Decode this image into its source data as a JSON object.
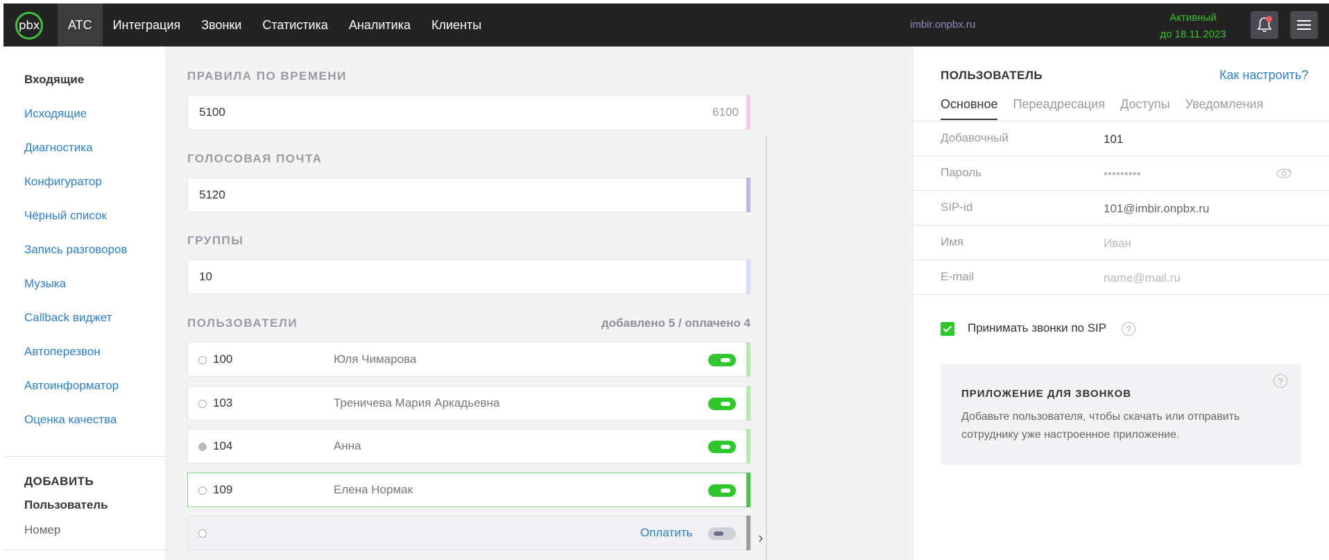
{
  "topbar": {
    "logo": "pbx",
    "nav": [
      "АТС",
      "Интеграция",
      "Звонки",
      "Статистика",
      "Аналитика",
      "Клиенты"
    ],
    "domain": "imbir.onpbx.ru",
    "status_line1": "Активный",
    "status_line2": "до 18.11.2023"
  },
  "sidebar": {
    "items": [
      "Входящие",
      "Исходящие",
      "Диагностика",
      "Конфигуратор",
      "Чёрный список",
      "Запись разговоров",
      "Музыка",
      "Callback виджет",
      "Автоперезвон",
      "Автоинформатор",
      "Оценка качества"
    ],
    "add_title": "ДОБАВИТЬ",
    "add_user": "Пользователь",
    "add_number": "Номер"
  },
  "middle": {
    "time_rules": {
      "title": "ПРАВИЛА ПО ВРЕМЕНИ",
      "value": "5100",
      "right": "6100",
      "bar_color": "#f7c9e6"
    },
    "voicemail": {
      "title": "ГОЛОСОВАЯ ПОЧТА",
      "value": "5120",
      "bar_color": "#c2b3ea"
    },
    "groups": {
      "title": "ГРУППЫ",
      "value": "10",
      "bar_color": "#d3dcfb"
    },
    "users": {
      "title": "ПОЛЬЗОВАТЕЛИ",
      "count": "добавлено 5 / оплачено 4",
      "rows": [
        {
          "ext": "100",
          "name": "Юля Чимарова"
        },
        {
          "ext": "103",
          "name": "Треничева Мария Аркадьевна"
        },
        {
          "ext": "104",
          "name": "Анна"
        },
        {
          "ext": "109",
          "name": "Елена Нормак"
        }
      ],
      "pay_label": "Оплатить"
    }
  },
  "user_panel": {
    "title": "ПОЛЬЗОВАТЕЛЬ",
    "help": "Как настроить?",
    "tabs": [
      "Основное",
      "Переадресация",
      "Доступы",
      "Уведомления"
    ],
    "fields": {
      "ext_label": "Добавочный",
      "ext_value": "101",
      "pass_label": "Пароль",
      "pass_value": "•••••••••",
      "sip_label": "SIP-id",
      "sip_value": "101@imbir.onpbx.ru",
      "name_label": "Имя",
      "name_placeholder": "Иван",
      "email_label": "E-mail",
      "email_placeholder": "name@mail.ru"
    },
    "sip_calls_label": "Принимать звонки по SIP",
    "app": {
      "title": "ПРИЛОЖЕНИЕ ДЛЯ ЗВОНКОВ",
      "text": "Добавьте пользователя, чтобы скачать или отправить сотруднику уже настроенное приложение."
    }
  }
}
